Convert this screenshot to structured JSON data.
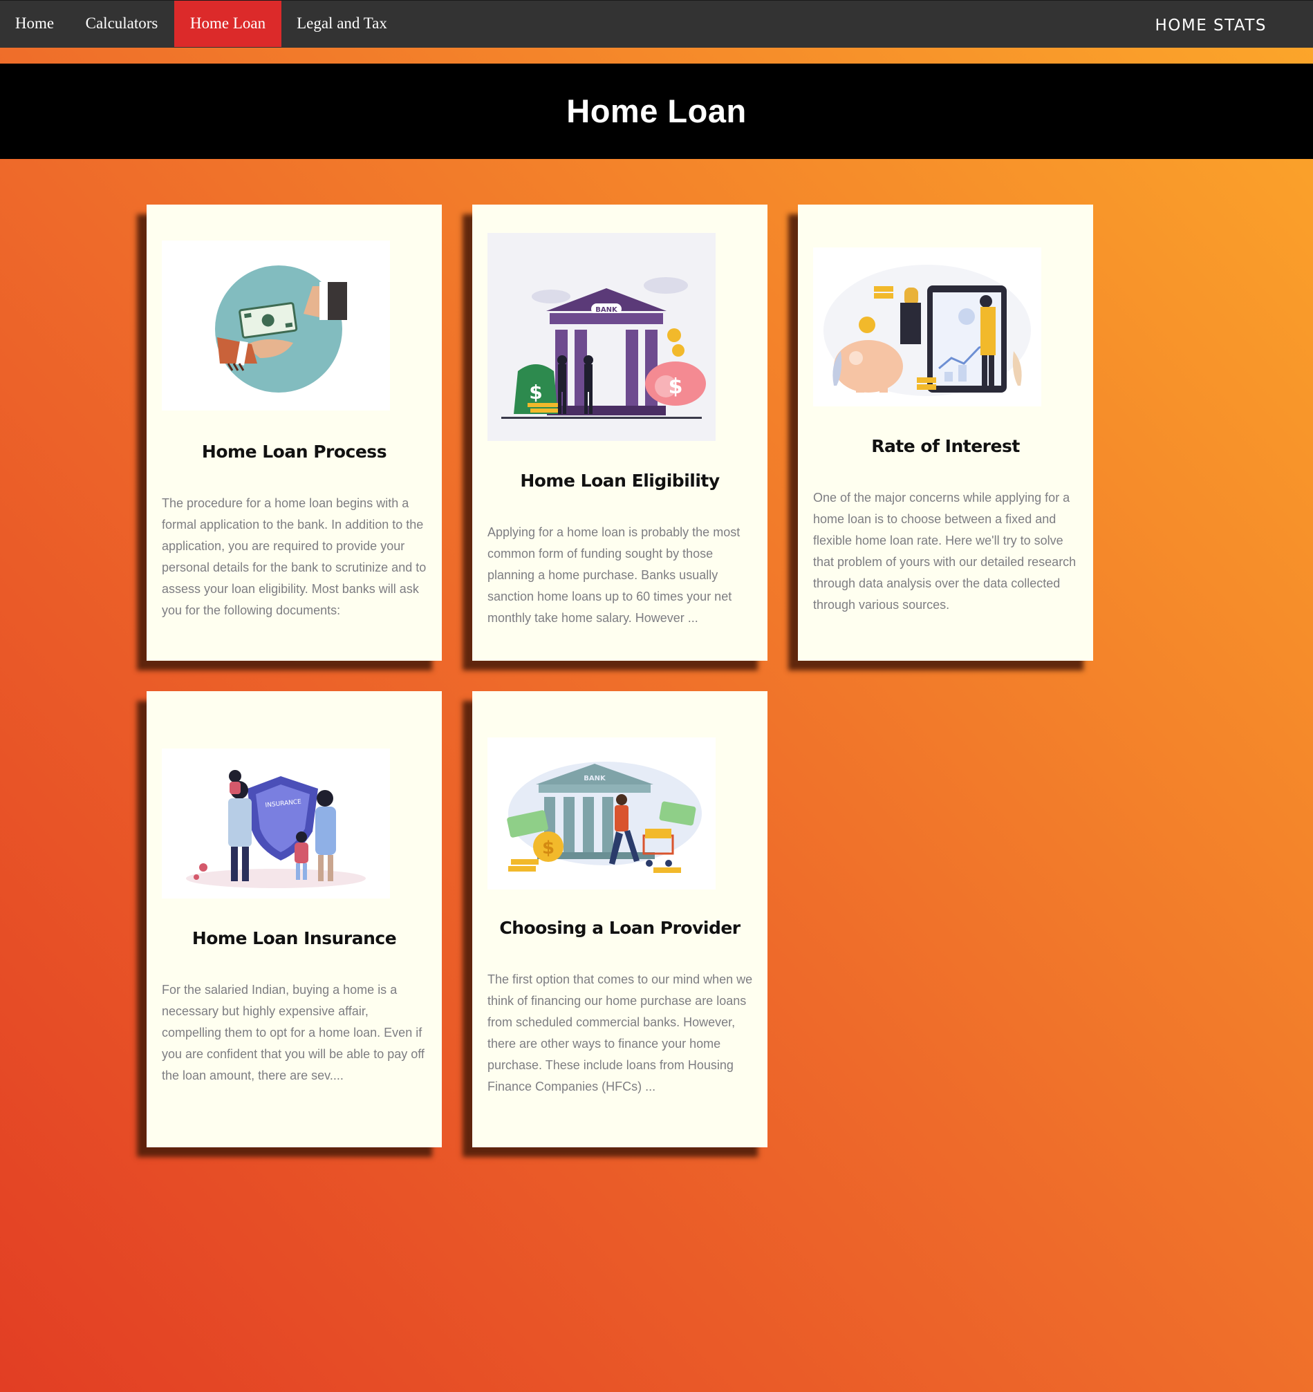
{
  "nav": {
    "items": [
      {
        "label": "Home"
      },
      {
        "label": "Calculators"
      },
      {
        "label": "Home Loan"
      },
      {
        "label": "Legal and Tax"
      }
    ],
    "active_index": 2,
    "brand": "HOME STATS"
  },
  "hero": {
    "title": "Home Loan"
  },
  "colors": {
    "nav_bg": "#333333",
    "nav_active": "#dc2a2a",
    "card_bg": "#fffff0",
    "gradient_start": "#e23e24",
    "gradient_end": "#fca72a"
  },
  "cards": [
    {
      "title": "Home Loan Process",
      "icon": "money-handover-illustration",
      "text": "The procedure for a home loan begins with a formal application to the bank. In addition to the application, you are required to provide your personal details for the bank to scrutinize and to assess your loan eligibility. Most banks will ask you for the following documents:"
    },
    {
      "title": "Home Loan Eligibility",
      "icon": "bank-building-illustration",
      "bank_label": "BANK",
      "text": "Applying for a home loan is probably the most common form of funding sought by those planning a home purchase. Banks usually sanction home loans up to 60 times your net monthly take home salary. However ..."
    },
    {
      "title": "Rate of Interest",
      "icon": "piggy-bank-analytics-illustration",
      "text": "One of the major concerns while applying for a home loan is to choose between a fixed and flexible home loan rate. Here we'll try to solve that problem of yours with our detailed research through data analysis over the data collected through various sources."
    },
    {
      "title": "Home Loan Insurance",
      "icon": "family-insurance-shield-illustration",
      "shield_label": "INSURANCE",
      "text": "For the salaried Indian, buying a home is a necessary but highly expensive affair, compelling them to opt for a home loan. Even if you are confident that you will be able to pay off the loan amount, there are sev...."
    },
    {
      "title": "Choosing a Loan Provider",
      "icon": "bank-cart-money-illustration",
      "bank_label": "BANK",
      "text": "The first option that comes to our mind when we think of financing our home purchase are loans from scheduled commercial banks. However, there are other ways to finance your home purchase. These include loans from Housing Finance Companies (HFCs) ..."
    }
  ]
}
